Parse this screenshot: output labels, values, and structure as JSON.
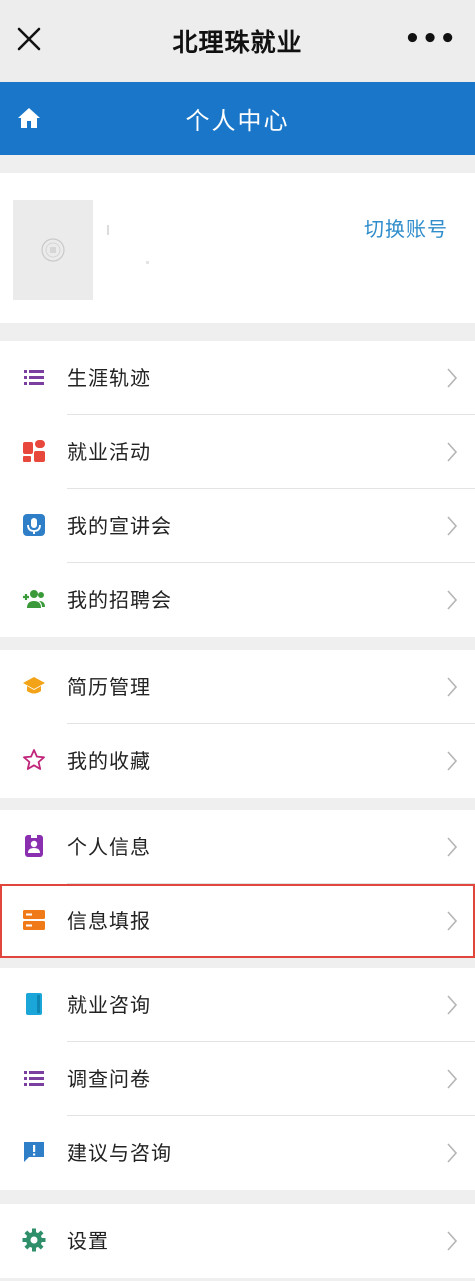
{
  "topbar": {
    "title": "北理珠就业",
    "more": "•••"
  },
  "bluebar": {
    "title": "个人中心"
  },
  "profile": {
    "switch_label": "切换账号"
  },
  "groups": [
    {
      "items": [
        {
          "label": "生涯轨迹",
          "icon": "list-icon",
          "color": "#7b3fa0"
        },
        {
          "label": "就业活动",
          "icon": "activity-icon",
          "color": "#e8473b"
        },
        {
          "label": "我的宣讲会",
          "icon": "microphone-icon",
          "color": "#2f7fc8"
        },
        {
          "label": "我的招聘会",
          "icon": "add-group-icon",
          "color": "#3a9a3a"
        }
      ]
    },
    {
      "items": [
        {
          "label": "简历管理",
          "icon": "graduation-cap-icon",
          "color": "#f2a317"
        },
        {
          "label": "我的收藏",
          "icon": "star-icon",
          "color": "#c0267a"
        }
      ]
    },
    {
      "items": [
        {
          "label": "个人信息",
          "icon": "id-badge-icon",
          "color": "#8a2fb0"
        },
        {
          "label": "信息填报",
          "icon": "form-icon",
          "color": "#f07a18",
          "highlighted": true
        }
      ]
    },
    {
      "items": [
        {
          "label": "就业咨询",
          "icon": "book-icon",
          "color": "#1aa6d8"
        },
        {
          "label": "调查问卷",
          "icon": "list-icon",
          "color": "#7b3fa0"
        },
        {
          "label": "建议与咨询",
          "icon": "feedback-icon",
          "color": "#2f7fc8"
        }
      ]
    },
    {
      "items": [
        {
          "label": "设置",
          "icon": "gear-icon",
          "color": "#2f8f6a"
        }
      ]
    }
  ]
}
